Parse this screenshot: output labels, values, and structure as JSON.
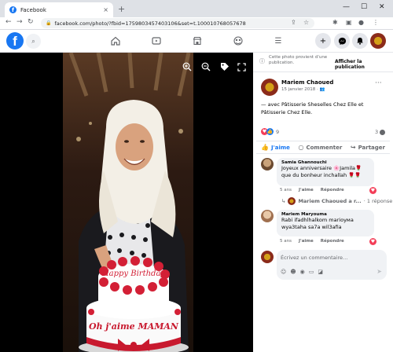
{
  "browser": {
    "tab_title": "Facebook",
    "tab_close": "×",
    "new_tab": "+",
    "url": "facebook.com/photo/?fbid=1759803457403106&set=t.100010768057678",
    "window_controls": [
      "—",
      "☐",
      "✕"
    ]
  },
  "header": {
    "logo_letter": "f",
    "nav_icons": [
      "home-icon",
      "watch-icon",
      "marketplace-icon",
      "groups-icon",
      "menu-icon"
    ],
    "right_icons": [
      "create-icon",
      "messenger-icon",
      "notifications-icon",
      "account-avatar"
    ]
  },
  "notice": {
    "text": "Cette photo provient d'une publication.",
    "link": "Afficher la publication"
  },
  "post": {
    "author": "Mariem Chaoued",
    "date": "15 janvier 2018 · ",
    "text": "— avec Pâtisserie Sheselles Chez Elle et Pâtisserie Chez Elle.",
    "reaction_count": "9",
    "comment_count": "3"
  },
  "actions": {
    "like": "J'aime",
    "comment": "Commenter",
    "share": "Partager"
  },
  "comments": [
    {
      "name": "Samia Ghannouchi",
      "text": "Joyeux anniversaire 🌸Jamila🌹 que du bonheur inchallah 🌹🌹",
      "time": "5 ans",
      "like": "J'aime",
      "reply": "Répondre"
    },
    {
      "name": "Mariem Maryouma",
      "text": "Rabi ifadhlhalkom marioума wya3taha sa7a wil3afia",
      "time": "5 ans",
      "like": "J'aime",
      "reply": "Répondre"
    }
  ],
  "reply_row": {
    "text": "Mariem Chaoued a r...",
    "count": "· 1 réponse"
  },
  "compose": {
    "placeholder": "Écrivez un commentaire…"
  },
  "cake_text": {
    "top": "Happy Birthday",
    "side": "Oh j'aime MAMAN"
  }
}
